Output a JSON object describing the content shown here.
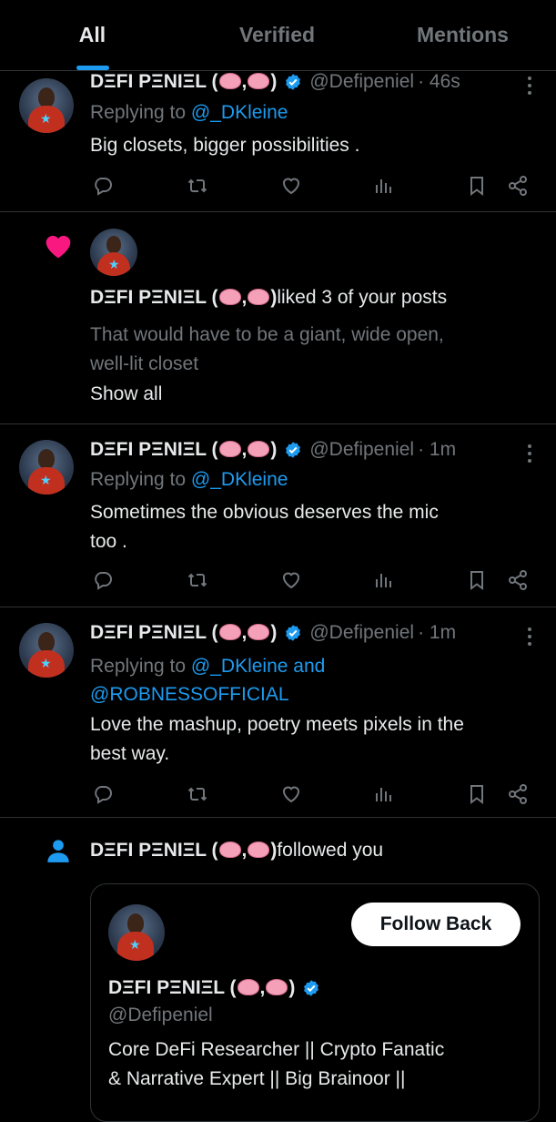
{
  "tabs": [
    {
      "label": "All",
      "active": true
    },
    {
      "label": "Verified",
      "active": false
    },
    {
      "label": "Mentions",
      "active": false
    }
  ],
  "user": {
    "name_prefix": "DΞFI PΞNIΞL (",
    "name_sep": ",",
    "name_suffix": ")",
    "handle": "@Defipeniel",
    "handle_line": "@Defipeniel",
    "bio_line1": "Core DeFi Researcher || Crypto Fanatic",
    "bio_line2": "& Narrative Expert || Big Brainoor ||",
    "icon_brain": "brain-emoji",
    "icon_verified": "verified-badge-icon"
  },
  "colors": {
    "background": "#000000",
    "accent": "#1d9bf0",
    "muted": "#71767b",
    "like": "#f91880"
  },
  "notifications": [
    {
      "type": "reply",
      "time_text": "· 46s",
      "replying_prefix": "Replying to ",
      "replying_to": "@_DKleine",
      "replying_and": "",
      "replying_to_2": "",
      "text_line1": "Big closets, bigger possibilities .",
      "text_line2": ""
    },
    {
      "type": "like",
      "action_text": " liked 3 of your posts",
      "preview_line1": "That would have to be a giant, wide open,",
      "preview_line2": "well-lit closet",
      "show_all": "Show all"
    },
    {
      "type": "reply",
      "time_text": "· 1m",
      "replying_prefix": "Replying to ",
      "replying_to": "@_DKleine",
      "replying_and": "",
      "replying_to_2": "",
      "text_line1": "Sometimes the obvious deserves the mic",
      "text_line2": "too ."
    },
    {
      "type": "reply",
      "time_text": "· 1m",
      "replying_prefix": "Replying to ",
      "replying_to": "@_DKleine",
      "replying_and": " and",
      "replying_to_2": "@ROBNESSOFFICIAL",
      "text_line1": "Love the mashup, poetry meets pixels in the",
      "text_line2": "best way."
    },
    {
      "type": "follow",
      "action_text": " followed you",
      "follow_back_label": "Follow Back"
    }
  ],
  "action_icons": [
    "reply-icon",
    "repost-icon",
    "like-icon",
    "views-icon",
    "bookmark-icon",
    "share-icon"
  ]
}
